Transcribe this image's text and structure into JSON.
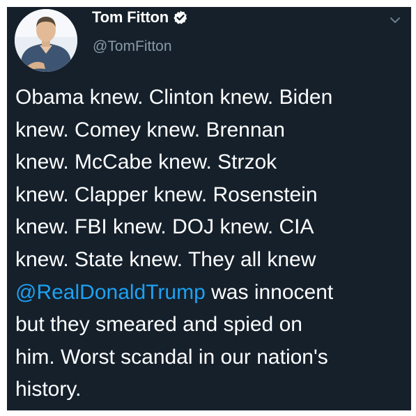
{
  "tweet": {
    "author": {
      "name": "Tom Fitton",
      "handle": "@TomFitton",
      "verified_icon": "verified-badge-icon",
      "avatar": "profile-photo"
    },
    "menu_icon": "chevron-down-icon",
    "lines": [
      {
        "text": "Obama knew. Clinton knew. Biden"
      },
      {
        "text": "knew. Comey knew. Brennan"
      },
      {
        "text": "knew. McCabe knew. Strzok"
      },
      {
        "text": "knew. Clapper knew. Rosenstein"
      },
      {
        "text": "knew. FBI knew. DOJ knew. CIA"
      },
      {
        "text": "knew. State knew. They all knew"
      },
      {
        "mention": "@RealDonaldTrump",
        "text": " was innocent"
      },
      {
        "text": "but they smeared and spied on"
      },
      {
        "text": "him. Worst scandal in our nation's"
      },
      {
        "text": "history."
      }
    ]
  },
  "colors": {
    "background": "#15202b",
    "text": "#ffffff",
    "secondary_text": "#8899a6",
    "link": "#1da1f2"
  }
}
